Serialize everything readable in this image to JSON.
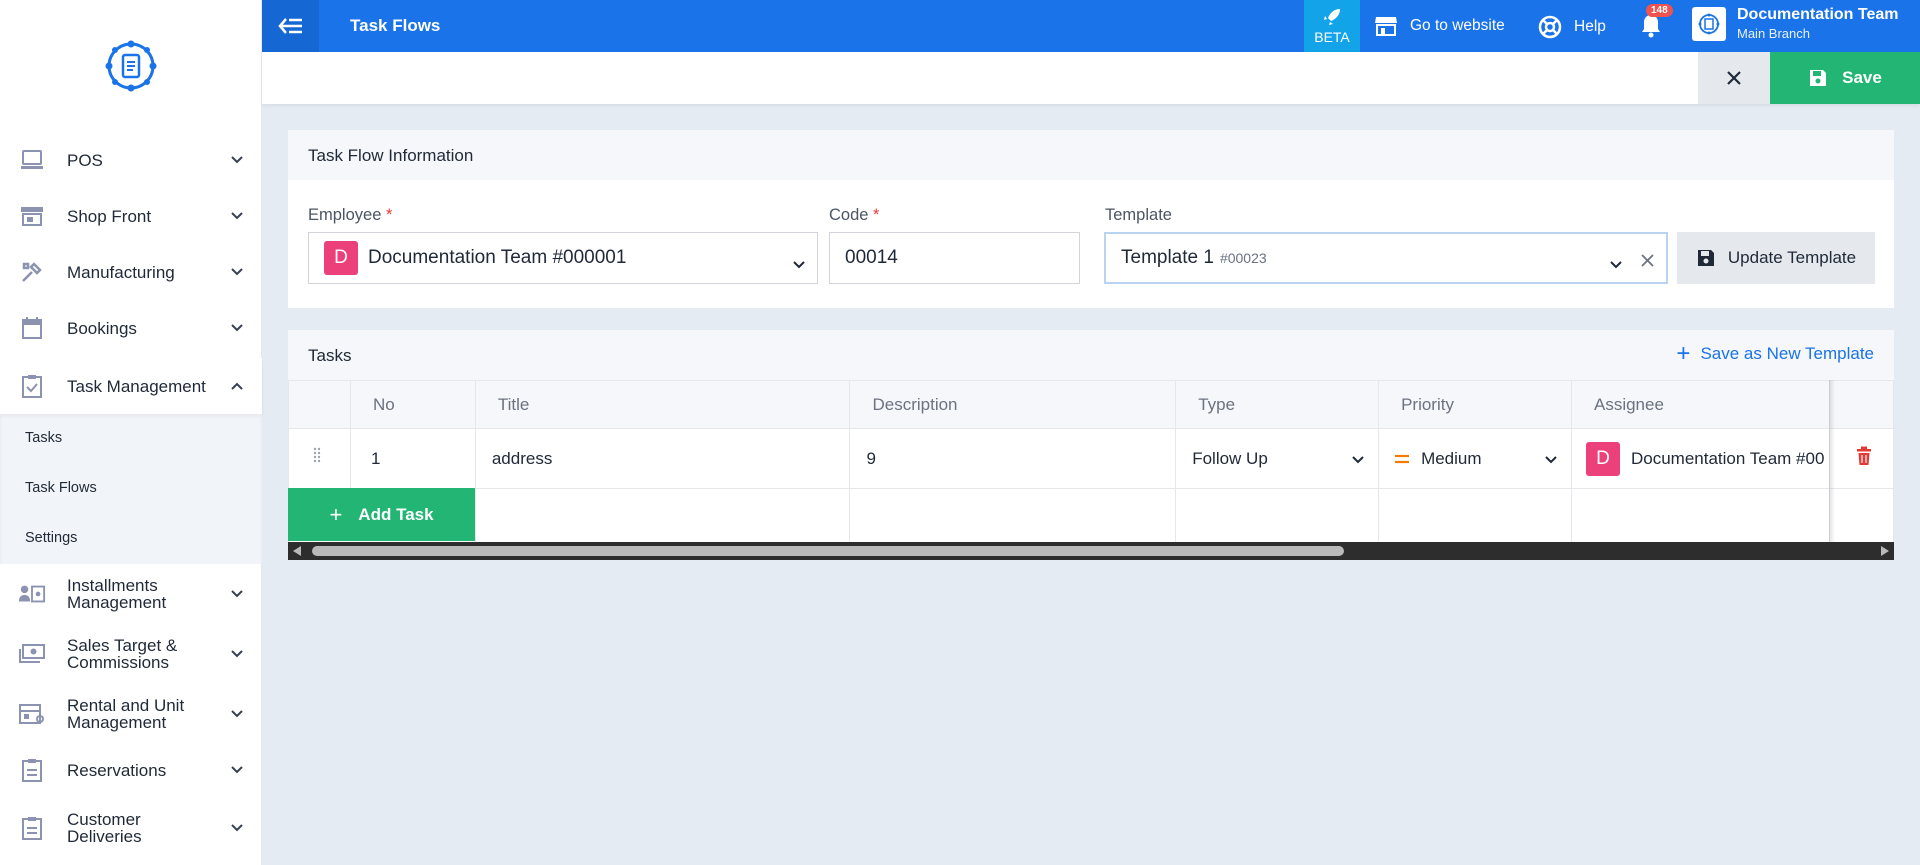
{
  "sidebar": {
    "items": [
      {
        "label": "POS"
      },
      {
        "label": "Shop Front"
      },
      {
        "label": "Manufacturing"
      },
      {
        "label": "Bookings"
      },
      {
        "label": "Task Management"
      },
      {
        "label": "Installments Management"
      },
      {
        "label": "Sales Target & Commissions"
      },
      {
        "label": "Rental and Unit Management"
      },
      {
        "label": "Reservations"
      },
      {
        "label": "Customer Deliveries"
      }
    ],
    "submenu": [
      "Tasks",
      "Task Flows",
      "Settings"
    ]
  },
  "header": {
    "title": "Task Flows",
    "beta": "BETA",
    "go_to_website": "Go to website",
    "help": "Help",
    "notifications": "148",
    "team_name": "Documentation Team",
    "branch": "Main Branch"
  },
  "actions": {
    "save": "Save"
  },
  "info": {
    "title": "Task Flow Information",
    "employee_label": "Employee",
    "employee_initial": "D",
    "employee_value": "Documentation Team #000001",
    "code_label": "Code",
    "code_value": "00014",
    "template_label": "Template",
    "template_value": "Template 1",
    "template_code": "#00023",
    "required": "*",
    "update_template": "Update Template"
  },
  "tasks": {
    "title": "Tasks",
    "save_as_new": "Save as New Template",
    "columns": [
      "No",
      "Title",
      "Description",
      "Type",
      "Priority",
      "Assignee"
    ],
    "rows": [
      {
        "no": "1",
        "title": "address",
        "description": "9",
        "type": "Follow Up",
        "priority": "Medium",
        "assignee_initial": "D",
        "assignee": "Documentation Team #00"
      }
    ],
    "add_task": "Add Task"
  },
  "colors": {
    "primary": "#1a73e8",
    "success": "#22b573",
    "chip": "#ec407a",
    "danger": "#e53935",
    "priority_medium": "#f57c00"
  }
}
